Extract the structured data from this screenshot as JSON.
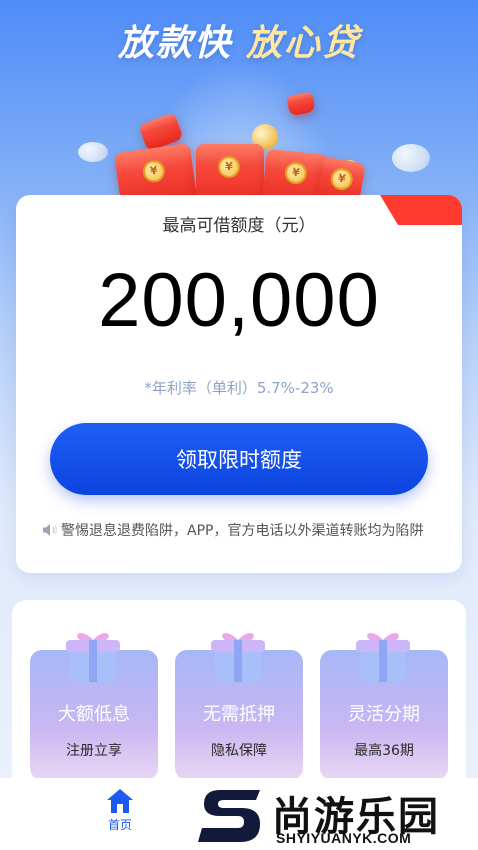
{
  "header": {
    "title_part1": "放款快",
    "title_part2": "放心贷"
  },
  "quota_card": {
    "label": "最高可借额度（元）",
    "amount": "200,000",
    "rate": "*年利率（单利）5.7%-23%",
    "claim_button": "领取限时额度",
    "notice": "警惕退息退费陷阱，APP，官方电话以外渠道转账均为陷阱",
    "envelope_glyph": "¥"
  },
  "features": [
    {
      "title": "大额低息",
      "subtitle": "注册立享",
      "icon": "gift-icon"
    },
    {
      "title": "无需抵押",
      "subtitle": "隐私保障",
      "icon": "gift-icon"
    },
    {
      "title": "灵活分期",
      "subtitle": "最高36期",
      "icon": "gift-icon"
    }
  ],
  "tabbar": {
    "home_label": "首页",
    "home_icon": "home-icon"
  },
  "watermark": {
    "name": "尚游乐园",
    "url": "SHYIYUANYK.COM"
  },
  "colors": {
    "primary_button": "#1f5ef5",
    "badge_red": "#ff3b30",
    "rate_text": "#8ea3c8"
  }
}
